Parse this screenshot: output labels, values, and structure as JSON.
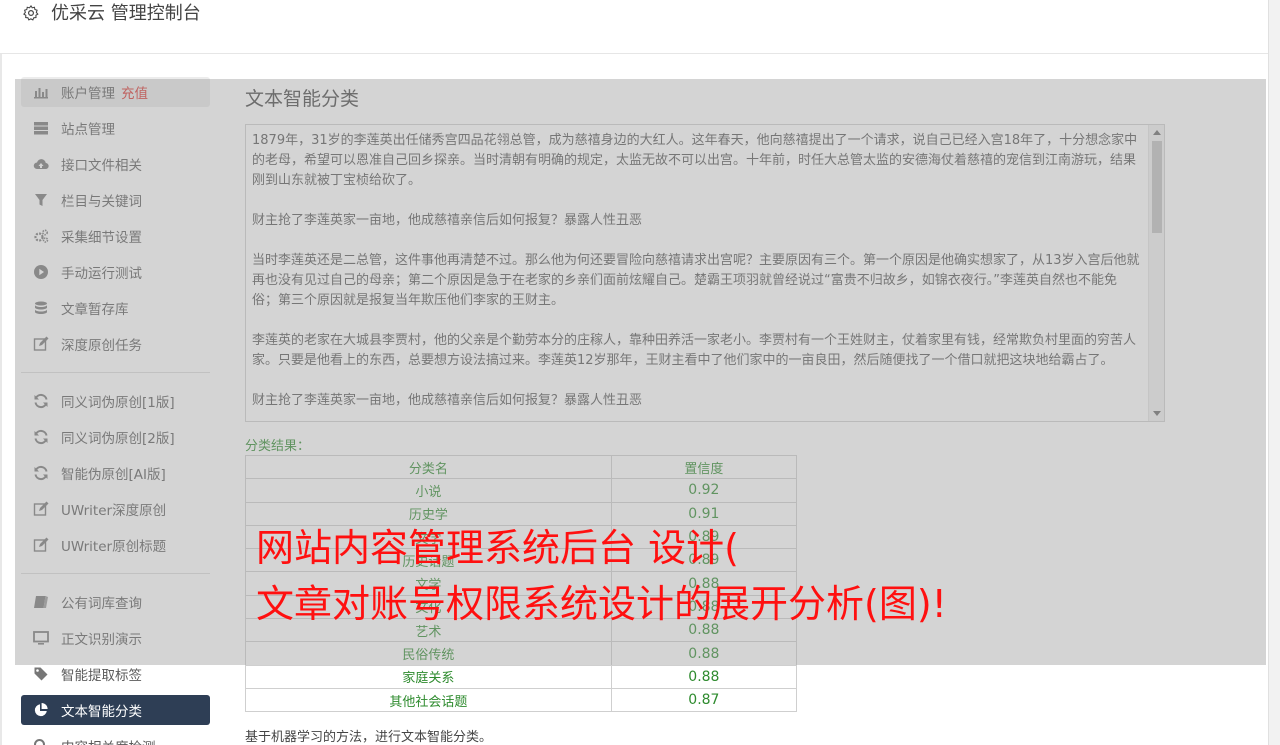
{
  "header": {
    "title": "优采云 管理控制台"
  },
  "sidebar": {
    "items": [
      {
        "label": "账户管理",
        "badge": "充值",
        "icon": "bar-chart-icon"
      },
      {
        "label": "站点管理",
        "icon": "server-icon"
      },
      {
        "label": "接口文件相关",
        "icon": "cloud-upload-icon"
      },
      {
        "label": "栏目与关键词",
        "icon": "filter-icon"
      },
      {
        "label": "采集细节设置",
        "icon": "cogs-icon"
      },
      {
        "label": "手动运行测试",
        "icon": "play-circle-icon"
      },
      {
        "label": "文章暂存库",
        "icon": "database-icon"
      },
      {
        "label": "深度原创任务",
        "icon": "edit-icon"
      },
      {
        "label": "同义词伪原创[1版]",
        "icon": "refresh-icon"
      },
      {
        "label": "同义词伪原创[2版]",
        "icon": "refresh-icon"
      },
      {
        "label": "智能伪原创[AI版]",
        "icon": "refresh-icon"
      },
      {
        "label": "UWriter深度原创",
        "icon": "edit-icon"
      },
      {
        "label": "UWriter原创标题",
        "icon": "edit-icon"
      },
      {
        "label": "公有词库查询",
        "icon": "book-icon"
      },
      {
        "label": "正文识别演示",
        "icon": "monitor-icon"
      },
      {
        "label": "智能提取标签",
        "icon": "tag-icon"
      },
      {
        "label": "文本智能分类",
        "icon": "pie-chart-icon"
      },
      {
        "label": "内容相关度检测",
        "icon": "search-icon"
      }
    ]
  },
  "main": {
    "title": "文本智能分类",
    "text_paragraphs": [
      "1879年，31岁的李莲英出任储秀宫四品花翎总管，成为慈禧身边的大红人。这年春天，他向慈禧提出了一个请求，说自己已经入宫18年了，十分想念家中的老母，希望可以恩准自己回乡探亲。当时清朝有明确的规定，太监无故不可以出宫。十年前，时任大总管太监的安德海仗着慈禧的宠信到江南游玩，结果刚到山东就被丁宝桢给砍了。",
      "财主抢了李莲英家一亩地，他成慈禧亲信后如何报复？暴露人性丑恶",
      "当时李莲英还是二总管，这件事他再清楚不过。那么他为何还要冒险向慈禧请求出宫呢？主要原因有三个。第一个原因是他确实想家了，从13岁入宫后他就再也没有见过自己的母亲；第二个原因是急于在老家的乡亲们面前炫耀自己。楚霸王项羽就曾经说过“富贵不归故乡，如锦衣夜行。”李莲英自然也不能免俗；第三个原因就是报复当年欺压他们李家的王财主。",
      "李莲英的老家在大城县李贾村，他的父亲是个勤劳本分的庄稼人，靠种田养活一家老小。李贾村有一个王姓财主，仗着家里有钱，经常欺负村里面的穷苦人家。只要是他看上的东西，总要想方设法搞过来。李莲英12岁那年，王财主看中了他们家中的一亩良田，然后随便找了一个借口就把这块地给霸占了。",
      "财主抢了李莲英家一亩地，他成慈禧亲信后如何报复？暴露人性丑恶"
    ],
    "result_label": "分类结果：",
    "table": {
      "headers": [
        "分类名",
        "置信度"
      ],
      "rows": [
        {
          "name": "小说",
          "score": "0.92"
        },
        {
          "name": "历史学",
          "score": "0.91"
        },
        {
          "name": "文学",
          "score": "0.89"
        },
        {
          "name": "历史话题",
          "score": "0.89"
        },
        {
          "name": "文学",
          "score": "0.88"
        },
        {
          "name": "文化",
          "score": "0.88"
        },
        {
          "name": "艺术",
          "score": "0.88"
        },
        {
          "name": "民俗传统",
          "score": "0.88"
        },
        {
          "name": "家庭关系",
          "score": "0.88"
        },
        {
          "name": "其他社会话题",
          "score": "0.87"
        }
      ]
    },
    "note": "基于机器学习的方法，进行文本智能分类。"
  },
  "watermark": {
    "line1": "网站内容管理系统后台 设计(",
    "line2": "文章对账号权限系统设计的展开分析(图)!"
  }
}
